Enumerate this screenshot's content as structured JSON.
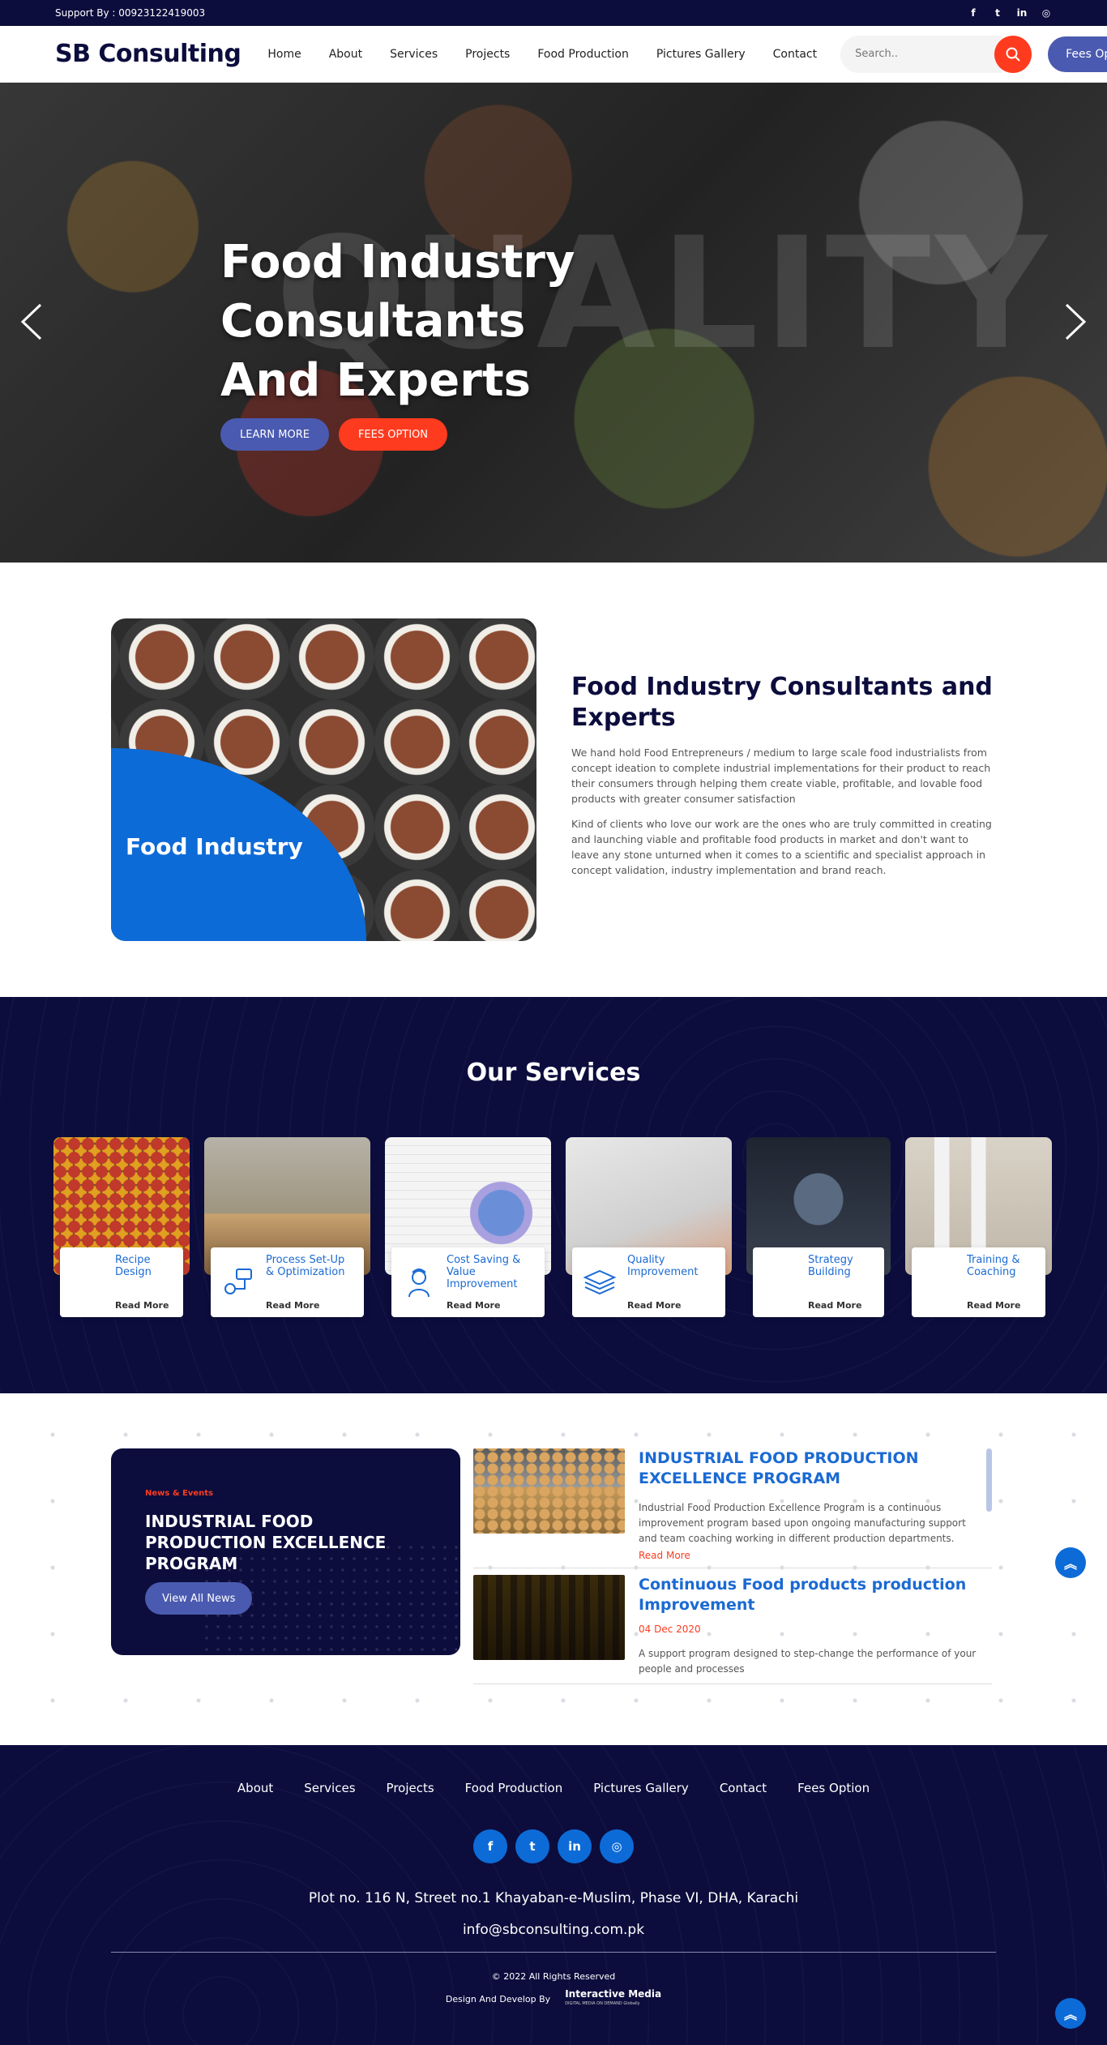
{
  "topbar": {
    "support": "Support By : 00923122419003",
    "socials": [
      "facebook-icon",
      "twitter-icon",
      "linkedin-icon",
      "instagram-icon"
    ]
  },
  "header": {
    "logo": "SB Consulting",
    "nav": [
      "Home",
      "About",
      "Services",
      "Projects",
      "Food Production",
      "Pictures Gallery",
      "Contact"
    ],
    "search_placeholder": "Search..",
    "fees_button": "Fees Option"
  },
  "hero": {
    "title_line1": "Food Industry Consultants",
    "title_line2": "And Experts",
    "learn_more": "LEARN MORE",
    "fees_option": "FEES OPTION",
    "watermark": "QUALITY"
  },
  "about": {
    "image_label": "Food Industry",
    "heading": "Food Industry Consultants and Experts",
    "para1": "We hand hold Food Entrepreneurs / medium to large scale food industrialists from concept ideation to complete industrial implementations for their product to reach their consumers through helping them create viable, profitable, and lovable food products with greater consumer satisfaction",
    "para2": "Kind of clients who love our work are the ones who are truly committed in creating and launching viable and profitable food products in market and don't want to leave any stone unturned when it comes to a scientific and specialist approach in concept validation, industry implementation and brand reach."
  },
  "services": {
    "heading": "Our Services",
    "items": [
      {
        "name": "Recipe Design",
        "more": "Read More",
        "icon": "spice-icon"
      },
      {
        "name": "Process Set-Up & Optimization",
        "more": "Read More",
        "icon": "process-icon"
      },
      {
        "name": "Cost Saving & Value Improvement",
        "more": "Read More",
        "icon": "chef-icon"
      },
      {
        "name": "Quality Improvement",
        "more": "Read More",
        "icon": "layers-icon"
      },
      {
        "name": "Strategy Building",
        "more": "Read More",
        "icon": "strategy-icon"
      },
      {
        "name": "Training & Coaching",
        "more": "Read More",
        "icon": "coaching-icon"
      }
    ]
  },
  "news": {
    "tag": "News & Events",
    "title": "INDUSTRIAL FOOD PRODUCTION EXCELLENCE PROGRAM",
    "button": "View All News",
    "items": [
      {
        "title": "INDUSTRIAL FOOD PRODUCTION EXCELLENCE PROGRAM",
        "body": "Industrial Food Production Excellence Program is a continuous improvement program based upon ongoing manufacturing support and team coaching working in different production departments.",
        "more": "Read More"
      },
      {
        "title": "Continuous Food products production Improvement",
        "date": "04 Dec 2020",
        "body": "A support program designed to step-change the performance of your people and processes"
      }
    ]
  },
  "footer": {
    "nav": [
      "About",
      "Services",
      "Projects",
      "Food Production",
      "Pictures Gallery",
      "Contact",
      "Fees Option"
    ],
    "address": "Plot no. 116 N, Street no.1 Khayaban-e-Muslim, Phase VI, DHA, Karachi",
    "email": "info@sbconsulting.com.pk",
    "copyright": "© 2022 All Rights Reserved",
    "developed_by": "Design And Develop By",
    "developer": "Interactive Media",
    "developer_tagline": "DIGITAL MEDIA ON DEMAND Globally"
  },
  "colors": {
    "navy": "#0c0d3d",
    "accent_blue": "#0d6bd8",
    "button_blue": "#4a5ab0",
    "accent_red": "#ff3b1f"
  }
}
